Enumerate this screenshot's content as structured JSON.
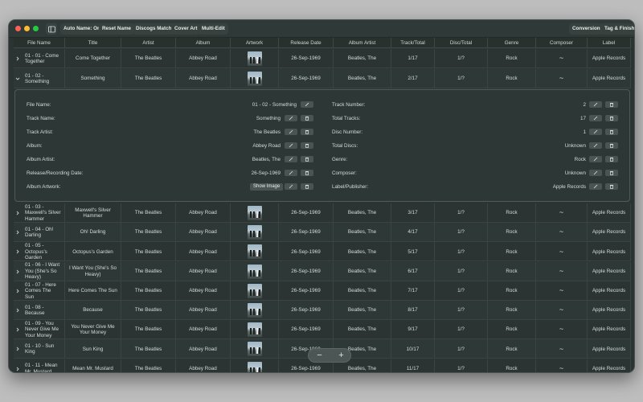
{
  "toolbar": {
    "auto_name": "Auto Name: On",
    "reset_name": "Reset Name",
    "discogs_match": "Discogs Match",
    "cover_art": "Cover Art",
    "multi_edit": "Multi-Edit",
    "conversion": "Conversion",
    "tag_finish": "Tag & Finish"
  },
  "columns": [
    "File Name",
    "Title",
    "Artist",
    "Album",
    "Artwork",
    "Release Date",
    "Album Artist",
    "Track/Total",
    "Disc/Total",
    "Genre",
    "Composer",
    "Label"
  ],
  "rows": [
    {
      "file": "01 - 01 - Come Together",
      "title": "Come Together",
      "artist": "The Beatles",
      "album": "Abbey Road",
      "date": "26-Sep-1969",
      "album_artist": "Beatles, The",
      "track": "1/17",
      "disc": "1/?",
      "genre": "Rock",
      "composer": "~",
      "label": "Apple Records"
    },
    {
      "file": "01 - 02 - Something",
      "title": "Something",
      "artist": "The Beatles",
      "album": "Abbey Road",
      "date": "26-Sep-1969",
      "album_artist": "Beatles, The",
      "track": "2/17",
      "disc": "1/?",
      "genre": "Rock",
      "composer": "~",
      "label": "Apple Records"
    },
    {
      "file": "01 - 03 - Maxwell's Silver Hammer",
      "title": "Maxwell's Silver Hammer",
      "artist": "The Beatles",
      "album": "Abbey Road",
      "date": "26-Sep-1969",
      "album_artist": "Beatles, The",
      "track": "3/17",
      "disc": "1/?",
      "genre": "Rock",
      "composer": "~",
      "label": "Apple Records"
    },
    {
      "file": "01 - 04 - Oh! Darling",
      "title": "Oh! Darling",
      "artist": "The Beatles",
      "album": "Abbey Road",
      "date": "26-Sep-1969",
      "album_artist": "Beatles, The",
      "track": "4/17",
      "disc": "1/?",
      "genre": "Rock",
      "composer": "~",
      "label": "Apple Records"
    },
    {
      "file": "01 - 05 - Octopus's Garden",
      "title": "Octopus's Garden",
      "artist": "The Beatles",
      "album": "Abbey Road",
      "date": "26-Sep-1969",
      "album_artist": "Beatles, The",
      "track": "5/17",
      "disc": "1/?",
      "genre": "Rock",
      "composer": "~",
      "label": "Apple Records"
    },
    {
      "file": "01 - 06 - I Want You (She's So Heavy)",
      "title": "I Want You (She's So Heavy)",
      "artist": "The Beatles",
      "album": "Abbey Road",
      "date": "26-Sep-1969",
      "album_artist": "Beatles, The",
      "track": "6/17",
      "disc": "1/?",
      "genre": "Rock",
      "composer": "~",
      "label": "Apple Records"
    },
    {
      "file": "01 - 07 - Here Comes The Sun",
      "title": "Here Comes The Sun",
      "artist": "The Beatles",
      "album": "Abbey Road",
      "date": "26-Sep-1969",
      "album_artist": "Beatles, The",
      "track": "7/17",
      "disc": "1/?",
      "genre": "Rock",
      "composer": "~",
      "label": "Apple Records"
    },
    {
      "file": "01 - 08 - Because",
      "title": "Because",
      "artist": "The Beatles",
      "album": "Abbey Road",
      "date": "26-Sep-1969",
      "album_artist": "Beatles, The",
      "track": "8/17",
      "disc": "1/?",
      "genre": "Rock",
      "composer": "~",
      "label": "Apple Records"
    },
    {
      "file": "01 - 09 - You Never Give Me Your Money",
      "title": "You Never Give Me Your Money",
      "artist": "The Beatles",
      "album": "Abbey Road",
      "date": "26-Sep-1969",
      "album_artist": "Beatles, The",
      "track": "9/17",
      "disc": "1/?",
      "genre": "Rock",
      "composer": "~",
      "label": "Apple Records"
    },
    {
      "file": "01 - 10 - Sun King",
      "title": "Sun King",
      "artist": "The Beatles",
      "album": "Abbey Road",
      "date": "26-Sep-1969",
      "album_artist": "Beatles, The",
      "track": "10/17",
      "disc": "1/?",
      "genre": "Rock",
      "composer": "~",
      "label": "Apple Records"
    },
    {
      "file": "01 - 11 - Mean Mr. Mustard",
      "title": "Mean Mr. Mustard",
      "artist": "The Beatles",
      "album": "Abbey Road",
      "date": "26-Sep-1969",
      "album_artist": "Beatles, The",
      "track": "11/17",
      "disc": "1/?",
      "genre": "Rock",
      "composer": "~",
      "label": "Apple Records"
    }
  ],
  "detail": {
    "left": [
      {
        "label": "File Name:",
        "value": "01 - 02 - Something",
        "has_delete": false
      },
      {
        "label": "Track Name:",
        "value": "Something",
        "has_delete": true
      },
      {
        "label": "Track Artist:",
        "value": "The Beatles",
        "has_delete": true
      },
      {
        "label": "Album:",
        "value": "Abbey Road",
        "has_delete": true
      },
      {
        "label": "Album Artist:",
        "value": "Beatles, The",
        "has_delete": true
      },
      {
        "label": "Release/Recording Date:",
        "value": "26-Sep-1969",
        "has_delete": true
      },
      {
        "label": "Album Artwork:",
        "value": "Show Image",
        "has_delete": true
      }
    ],
    "right": [
      {
        "label": "Track Number:",
        "value": "2"
      },
      {
        "label": "Total Tracks:",
        "value": "17"
      },
      {
        "label": "Disc Number:",
        "value": "1"
      },
      {
        "label": "Total Discs:",
        "value": "Unknown"
      },
      {
        "label": "Genre:",
        "value": "Rock"
      },
      {
        "label": "Composer:",
        "value": "Unknown"
      },
      {
        "label": "Label/Publisher:",
        "value": "Apple Records"
      }
    ]
  },
  "zoom": {
    "minus": "−",
    "plus": "+"
  },
  "icons": {
    "edit": "pencil-icon",
    "delete": "trash-icon",
    "expand": "chevron-right-icon",
    "collapse": "chevron-down-icon"
  },
  "colors": {
    "window_bg": "#2b3433",
    "close": "#fe5f57",
    "minimize": "#febc2e",
    "zoom": "#28c840"
  }
}
